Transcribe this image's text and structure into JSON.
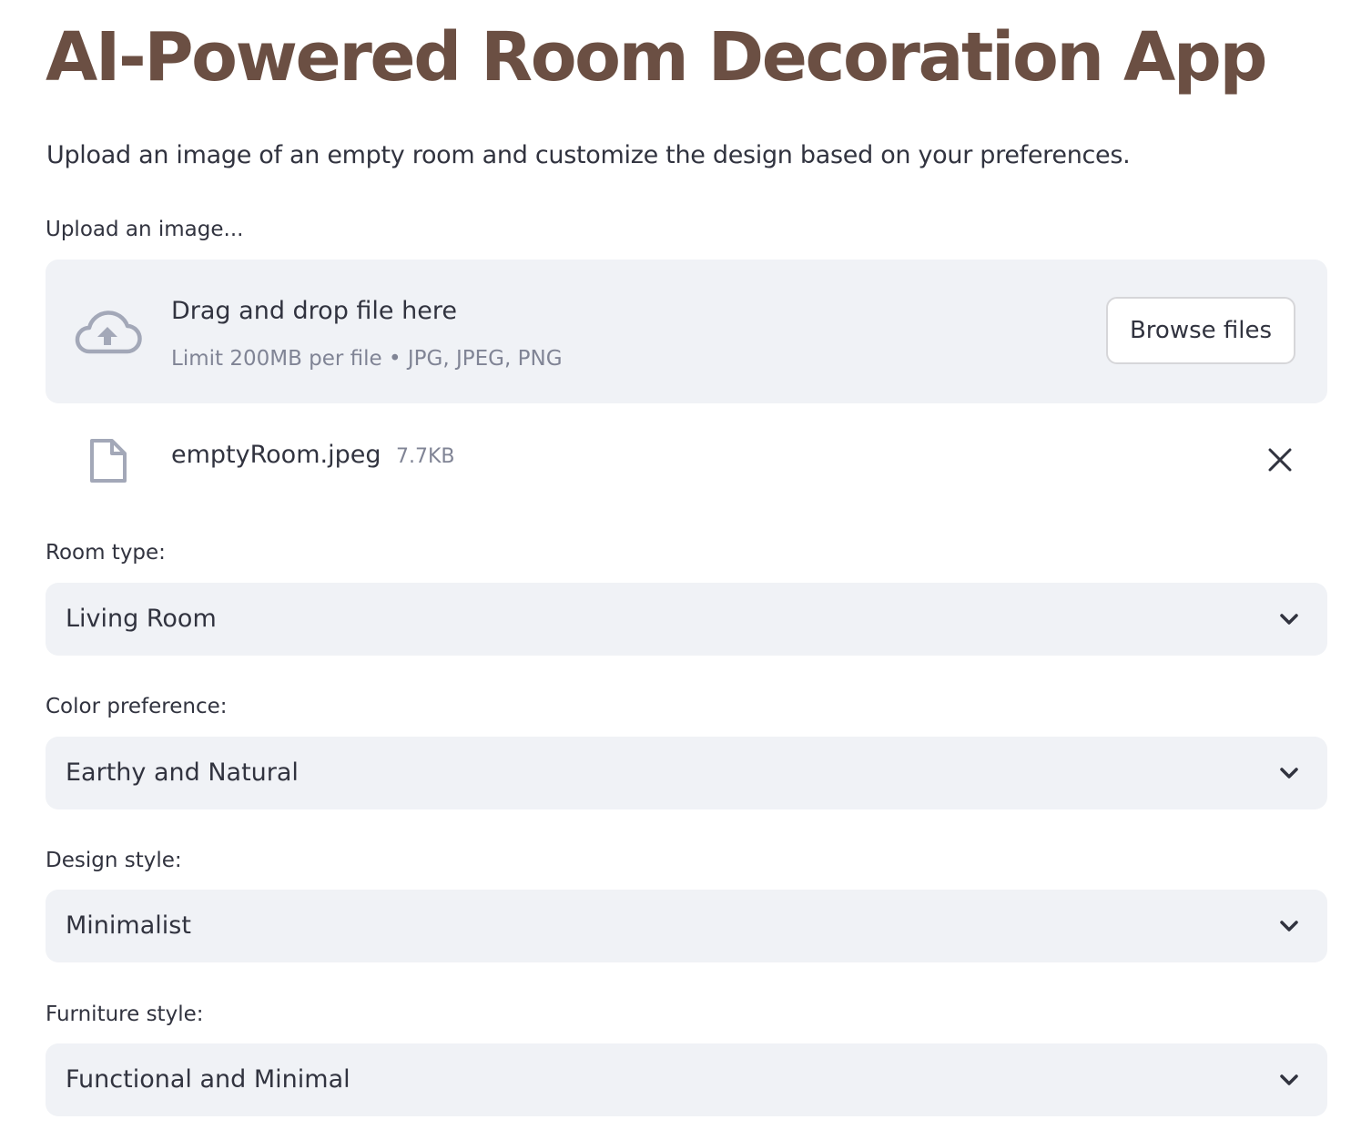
{
  "page": {
    "title": "AI-Powered Room Decoration App",
    "subtitle": "Upload an image of an empty room and customize the design based on your preferences."
  },
  "upload": {
    "label": "Upload an image...",
    "dropzone_title": "Drag and drop file here",
    "dropzone_limit": "Limit 200MB per file • JPG, JPEG, PNG",
    "browse_button": "Browse files",
    "upload_icon": "cloud-upload-icon",
    "file": {
      "name": "emptyRoom.jpeg",
      "size": "7.7KB",
      "file_icon": "file-icon",
      "remove_icon": "close-icon"
    }
  },
  "selects": [
    {
      "label": "Room type:",
      "value": "Living Room"
    },
    {
      "label": "Color preference:",
      "value": "Earthy and Natural"
    },
    {
      "label": "Design style:",
      "value": "Minimalist"
    },
    {
      "label": "Furniture style:",
      "value": "Functional and Minimal"
    }
  ],
  "colors": {
    "title": "#6b4f43",
    "text": "#31333f",
    "muted": "#808495",
    "surface": "#f0f2f6",
    "icon": "#a3a8b8"
  }
}
